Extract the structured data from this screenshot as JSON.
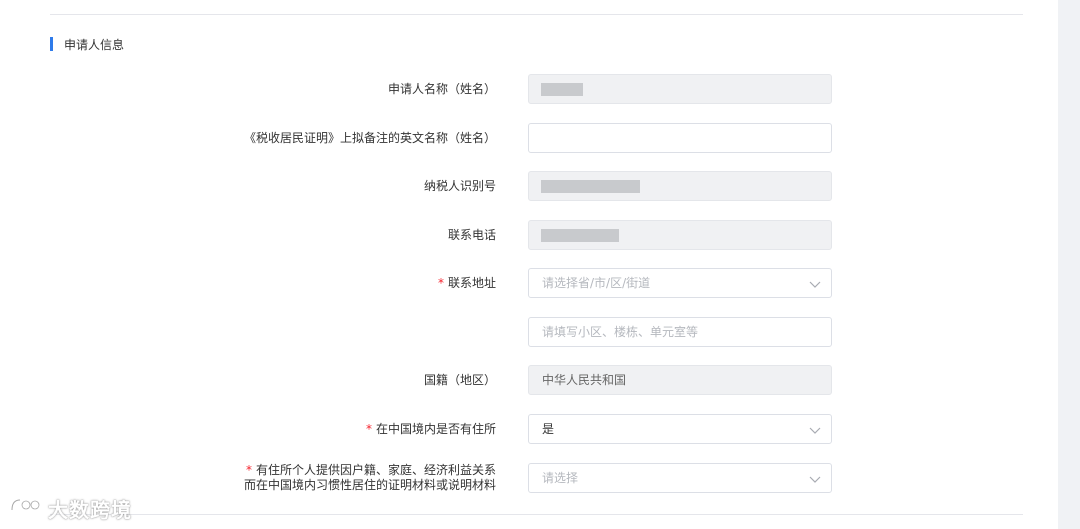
{
  "section": {
    "title": "申请人信息"
  },
  "fields": {
    "applicant_name": {
      "label": "申请人名称（姓名）"
    },
    "english_name": {
      "label": "《税收居民证明》上拟备注的英文名称（姓名）",
      "value": ""
    },
    "taxpayer_id": {
      "label": "纳税人识别号"
    },
    "phone": {
      "label": "联系电话"
    },
    "address": {
      "label": "联系地址",
      "region_placeholder": "请选择省/市/区/街道",
      "detail_placeholder": "请填写小区、楼栋、单元室等"
    },
    "nationality": {
      "label": "国籍（地区）",
      "value": "中华人民共和国"
    },
    "residence": {
      "label": "在中国境内是否有住所",
      "value": "是"
    },
    "proof": {
      "label_line1": "有住所个人提供因户籍、家庭、经济利益关系",
      "label_line2": "而在中国境内习惯性居住的证明材料或说明材料",
      "placeholder": "请选择"
    }
  },
  "required_mark": "*",
  "watermark": {
    "text": "大数跨境"
  },
  "colors": {
    "accent": "#2f7bea",
    "required": "#f5222d",
    "disabled_bg": "#f0f1f3"
  }
}
